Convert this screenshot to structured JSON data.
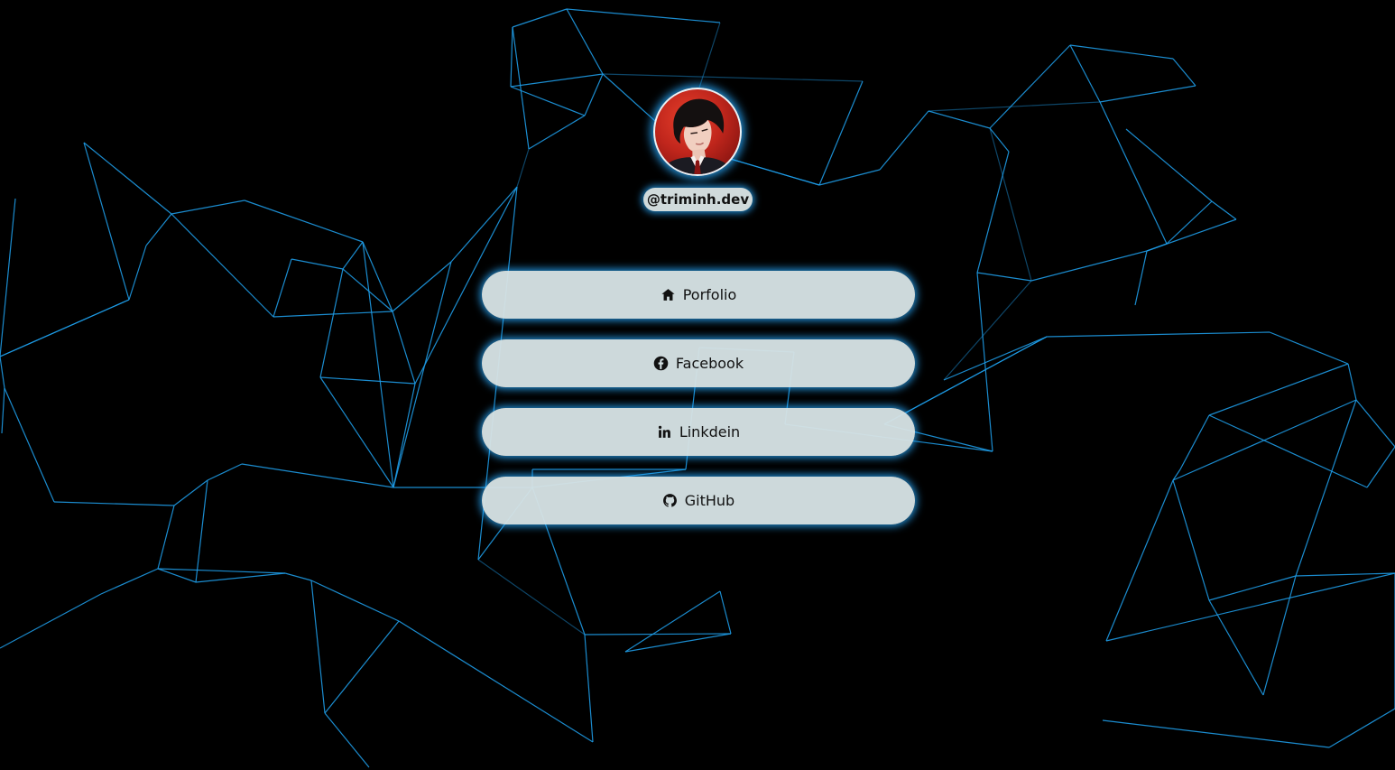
{
  "profile": {
    "handle": "@triminh.dev",
    "avatar_icon": "profile-photo"
  },
  "links": [
    {
      "label": "Porfolio",
      "icon": "home-icon"
    },
    {
      "label": "Facebook",
      "icon": "facebook-icon"
    },
    {
      "label": "Linkdein",
      "icon": "linkedin-icon"
    },
    {
      "label": "GitHub",
      "icon": "github-icon"
    }
  ],
  "theme": {
    "background": "#000000",
    "network_line": "#1e9be6",
    "glow": "#28aaff",
    "button_bg": "#d5e2e4",
    "text": "#111111"
  }
}
